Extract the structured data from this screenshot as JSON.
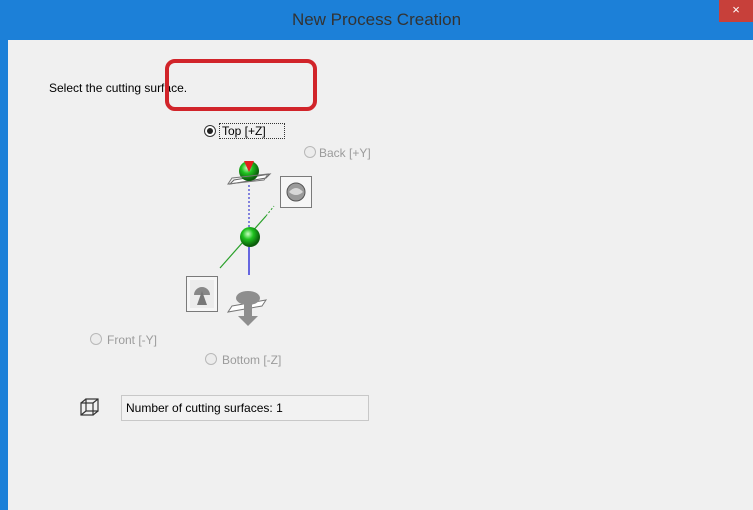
{
  "window": {
    "title": "New Process Creation",
    "close_glyph": "×",
    "title_bar_color": "#1c80d8",
    "close_color": "#c7403a"
  },
  "main": {
    "instruction": "Select the cutting surface.",
    "options": {
      "top": {
        "label": "Top [+Z]",
        "selected": true,
        "enabled": true
      },
      "back": {
        "label": "Back [+Y]",
        "selected": false,
        "enabled": false
      },
      "front": {
        "label": "Front [-Y]",
        "selected": false,
        "enabled": false
      },
      "bottom": {
        "label": "Bottom [-Z]",
        "selected": false,
        "enabled": false
      }
    },
    "count_field": {
      "value": "Number of cutting surfaces: 1"
    },
    "highlight_color": "#d1242a"
  },
  "icons": {
    "close": "close-icon",
    "axis_diagram": "axis-diagram-icon",
    "back_view": "back-view-icon",
    "front_view": "front-view-icon",
    "top_view": "top-view-icon",
    "bottom_view": "bottom-view-icon",
    "cube": "cube-icon"
  }
}
